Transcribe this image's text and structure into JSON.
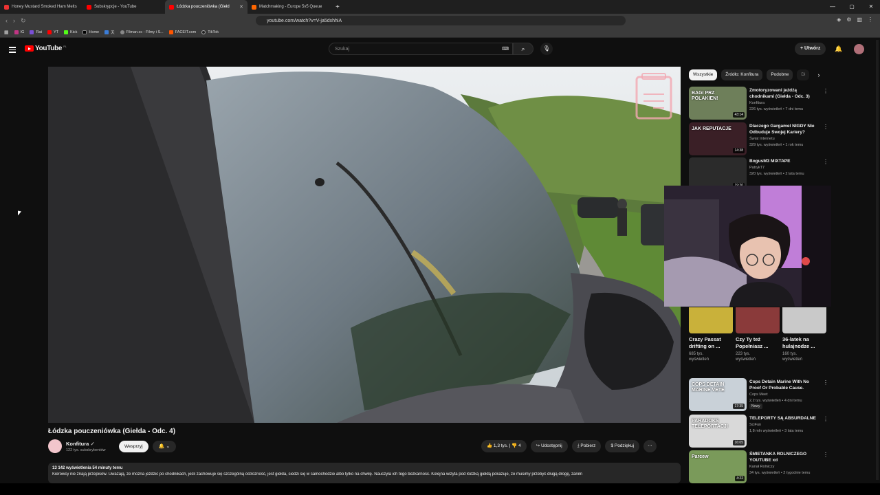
{
  "browser": {
    "tabs": [
      {
        "label": "Honey Mustard Smoked Ham Melts"
      },
      {
        "label": "Subskrypcje - YouTube"
      },
      {
        "label": "Łódzka pouczeniówka (Giełd"
      },
      {
        "label": "Matchmaking - Europe 5v5 Queue"
      }
    ],
    "url": "youtube.com/watch?v=V-ja5dxhhiA",
    "bookmarks": [
      "IG",
      "Rat",
      "YT",
      "Kick",
      "Home",
      "天",
      "Filman.cc - Filmy i S...",
      "FACEIT.com",
      "TikTok"
    ]
  },
  "header": {
    "logo": "YouTube",
    "logo_region": "PL",
    "search_placeholder": "Szukaj",
    "create_label": "Utwórz"
  },
  "video": {
    "title": "Łódzka pouczeniówka (Giełda - Odc. 4)",
    "channel": "Konfitura",
    "subscribers": "122 tys. subskrybentów",
    "support_label": "Wesprzyj",
    "likes": "1,3 tys.",
    "dislikes": "4",
    "share_label": "Udostępnij",
    "download_label": "Pobierz",
    "thanks_label": "Podziękuj",
    "views": "13 142 wyświetlenia",
    "age": "54 minuty temu",
    "description": "Kierowcy nie znają przepisów. Uważają, że można jeździć po chodnikach, jeśli zachowuje się szczególną ostrożność, jest giełda, siedzi się w samochodzie albo tylko na chwilę. Nauczyła ich tego bezkarność. Kolejna wizyta pod łódzką giełdą pokazuje, że musimy przebyć długą drogę, zanim"
  },
  "sidebar": {
    "chips": [
      "Wszystkie",
      "Źródło: Konfitura",
      "Podobne",
      "Di"
    ],
    "recommendations": [
      {
        "title": "Zmotoryzowani jeźdźą chodnikami (Giełda - Odc. 3)",
        "channel": "Konfitura",
        "meta": "226 tys. wyświetleń • 7 dni temu",
        "duration": "43:14",
        "thumb_text": "BAGI PRZ POLAKIEN!",
        "color": "#6e7f5a"
      },
      {
        "title": "Dlaczego Gargamel NIGDY Nie Odbuduje Swojej Kariery?",
        "channel": "Świat Internetu",
        "meta": "329 tys. wyświetleń • 1 rok temu",
        "duration": "14:38",
        "thumb_text": "JAK REPUTACJE",
        "color": "#3a1f26"
      },
      {
        "title": "BogusM3 MIXTAPE",
        "channel": "PatrykT7",
        "meta": "320 tys. wyświetleń • 2 lata temu",
        "duration": "19:20",
        "thumb_text": "",
        "color": "#2b2b2b"
      },
      {
        "title": "Cops Detain Marine With No Proof Or Probable Cause.",
        "channel": "Cops Meet",
        "meta": "2,2 tys. wyświetleń • 4 dni temu",
        "badge": "Nowy",
        "duration": "17:35",
        "thumb_text": "COPS DETAIN MARINE VETE",
        "color": "#c9d1d8"
      },
      {
        "title": "TELEPORTY SĄ ABSURDALNE",
        "channel": "SciFun",
        "meta": "1,8 mln wyświetleń • 3 lata temu",
        "duration": "16:05",
        "thumb_text": "PARADOKS TELEPORTACJI",
        "color": "#d9d9d9"
      },
      {
        "title": "ŚMIETANKA ROLNICZEGO YOUTUBE xd",
        "channel": "Kanał Rolniczy",
        "meta": "34 tys. wyświetleń • 2 tygodnie temu",
        "duration": "4:22",
        "thumb_text": "Parcew",
        "color": "#7a9a5a"
      }
    ],
    "shorts": [
      {
        "title": "Crazy Passat drifting on ...",
        "views": "685 tys. wyświetleń",
        "color": "#c9b13a"
      },
      {
        "title": "Czy Ty też Popełniasz ...",
        "views": "223 tys. wyświetleń",
        "color": "#8a3a3a"
      },
      {
        "title": "36-latek na hulajnodze ...",
        "views": "160 tys. wyświetleń",
        "color": "#c9c9c9"
      }
    ]
  }
}
